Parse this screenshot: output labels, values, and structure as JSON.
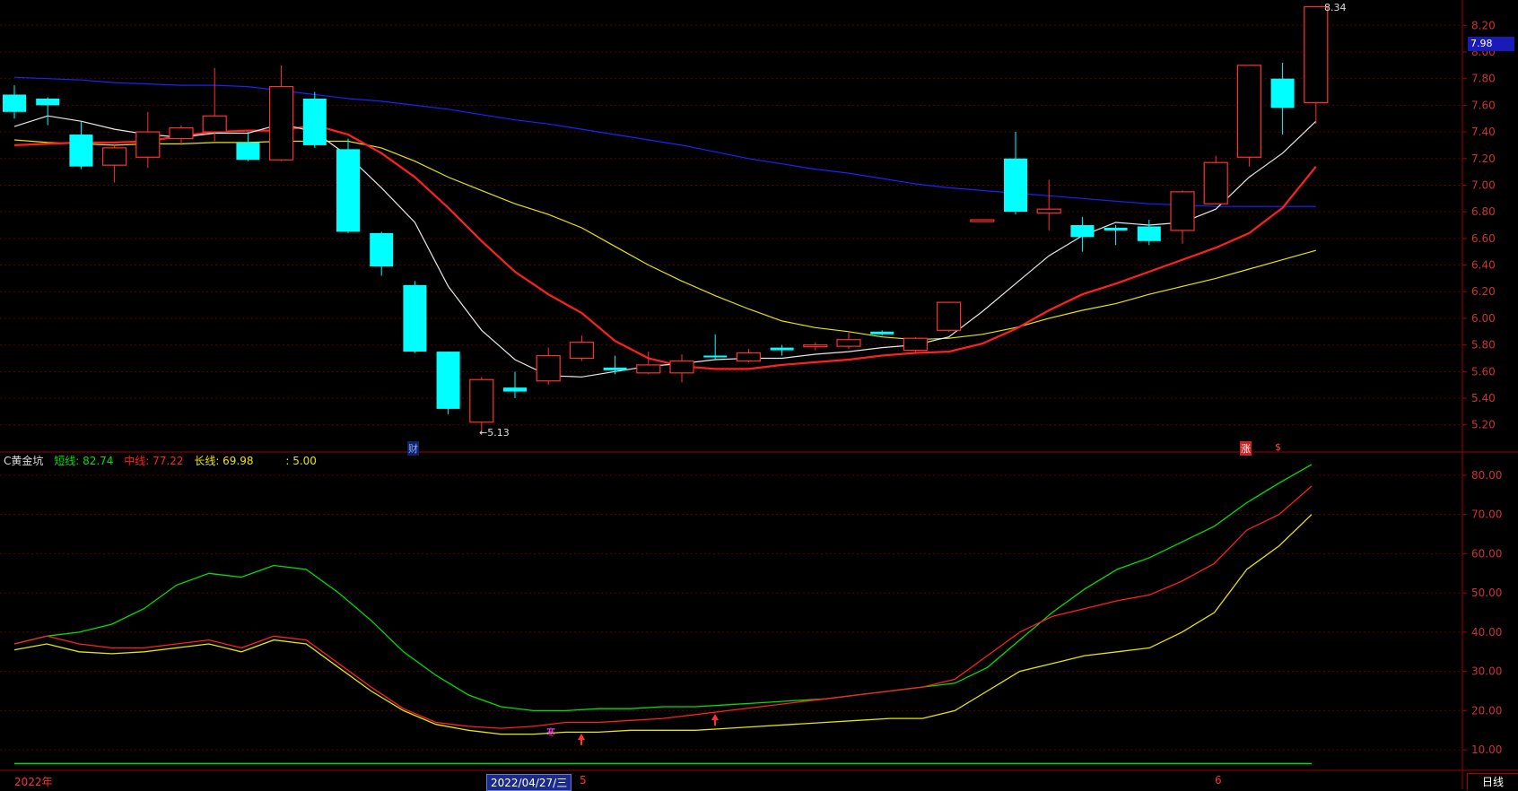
{
  "header": {
    "indicator_name": "C黄金坑",
    "short_label": "短线: 82.74",
    "mid_label": "中线: 77.22",
    "long_label": "长线: 69.98",
    "extra_label": ": 5.00"
  },
  "price_tag": "7.98",
  "x_labels": {
    "year": "2022年",
    "cursor_date": "2022/04/27/三",
    "m5": "5",
    "m6": "6"
  },
  "period": "日线",
  "markers": {
    "cai": "财",
    "zhang": "涨",
    "dollar": "$",
    "hi": "8.34",
    "lo": "←5.13",
    "han": "寒"
  },
  "colors": {
    "up": "#ff3030",
    "down": "#00ffff",
    "ma5": "#e8e8e8",
    "ma10": "#ff2020",
    "ma20": "#e6e600",
    "ma60": "#2020ff",
    "short": "#00e000",
    "mid": "#ff2020",
    "long": "#e6e600",
    "axis": "#a00000"
  },
  "chart_data": [
    {
      "type": "candlestick",
      "ylim": [
        5.05,
        8.35
      ],
      "yticks": [
        "5.20",
        "5.40",
        "5.60",
        "5.80",
        "6.00",
        "6.20",
        "6.40",
        "6.60",
        "6.80",
        "7.00",
        "7.20",
        "7.40",
        "7.60",
        "7.80",
        "8.00",
        "8.20"
      ],
      "candles": [
        {
          "o": 7.68,
          "h": 7.75,
          "l": 7.5,
          "c": 7.55
        },
        {
          "o": 7.65,
          "h": 7.66,
          "l": 7.45,
          "c": 7.6
        },
        {
          "o": 7.38,
          "h": 7.48,
          "l": 7.12,
          "c": 7.14
        },
        {
          "o": 7.15,
          "h": 7.3,
          "l": 7.02,
          "c": 7.28
        },
        {
          "o": 7.21,
          "h": 7.55,
          "l": 7.13,
          "c": 7.4
        },
        {
          "o": 7.35,
          "h": 7.45,
          "l": 7.3,
          "c": 7.43
        },
        {
          "o": 7.4,
          "h": 7.88,
          "l": 7.33,
          "c": 7.52
        },
        {
          "o": 7.32,
          "h": 7.4,
          "l": 7.18,
          "c": 7.19
        },
        {
          "o": 7.19,
          "h": 7.9,
          "l": 7.18,
          "c": 7.74
        },
        {
          "o": 7.65,
          "h": 7.7,
          "l": 7.28,
          "c": 7.3
        },
        {
          "o": 7.27,
          "h": 7.35,
          "l": 6.64,
          "c": 6.65
        },
        {
          "o": 6.64,
          "h": 6.65,
          "l": 6.32,
          "c": 6.39
        },
        {
          "o": 6.25,
          "h": 6.28,
          "l": 5.74,
          "c": 5.75
        },
        {
          "o": 5.75,
          "h": 5.75,
          "l": 5.28,
          "c": 5.32
        },
        {
          "o": 5.22,
          "h": 5.56,
          "l": 5.13,
          "c": 5.54
        },
        {
          "o": 5.48,
          "h": 5.6,
          "l": 5.4,
          "c": 5.45
        },
        {
          "o": 5.53,
          "h": 5.78,
          "l": 5.5,
          "c": 5.72
        },
        {
          "o": 5.7,
          "h": 5.87,
          "l": 5.68,
          "c": 5.82
        },
        {
          "o": 5.63,
          "h": 5.72,
          "l": 5.58,
          "c": 5.61
        },
        {
          "o": 5.59,
          "h": 5.75,
          "l": 5.58,
          "c": 5.65
        },
        {
          "o": 5.59,
          "h": 5.73,
          "l": 5.52,
          "c": 5.68
        },
        {
          "o": 5.72,
          "h": 5.88,
          "l": 5.69,
          "c": 5.71
        },
        {
          "o": 5.68,
          "h": 5.77,
          "l": 5.67,
          "c": 5.74
        },
        {
          "o": 5.78,
          "h": 5.8,
          "l": 5.72,
          "c": 5.76
        },
        {
          "o": 5.79,
          "h": 5.82,
          "l": 5.76,
          "c": 5.8
        },
        {
          "o": 5.79,
          "h": 5.9,
          "l": 5.77,
          "c": 5.84
        },
        {
          "o": 5.9,
          "h": 5.91,
          "l": 5.87,
          "c": 5.88
        },
        {
          "o": 5.76,
          "h": 5.86,
          "l": 5.74,
          "c": 5.85
        },
        {
          "o": 5.91,
          "h": 6.12,
          "l": 5.9,
          "c": 6.12
        },
        {
          "o": 6.74,
          "h": 6.74,
          "l": 6.74,
          "c": 6.74
        },
        {
          "o": 7.2,
          "h": 7.4,
          "l": 6.78,
          "c": 6.8
        },
        {
          "o": 6.79,
          "h": 7.04,
          "l": 6.66,
          "c": 6.82
        },
        {
          "o": 6.7,
          "h": 6.76,
          "l": 6.5,
          "c": 6.61
        },
        {
          "o": 6.68,
          "h": 6.7,
          "l": 6.55,
          "c": 6.66
        },
        {
          "o": 6.69,
          "h": 6.74,
          "l": 6.55,
          "c": 6.58
        },
        {
          "o": 6.66,
          "h": 6.96,
          "l": 6.56,
          "c": 6.95
        },
        {
          "o": 6.86,
          "h": 7.22,
          "l": 6.86,
          "c": 7.17
        },
        {
          "o": 7.21,
          "h": 7.9,
          "l": 7.14,
          "c": 7.9
        },
        {
          "o": 7.8,
          "h": 7.92,
          "l": 7.38,
          "c": 7.58
        },
        {
          "o": 7.62,
          "h": 8.34,
          "l": 7.46,
          "c": 8.34
        }
      ],
      "ma5": [
        7.44,
        7.52,
        7.48,
        7.42,
        7.38,
        7.36,
        7.39,
        7.39,
        7.46,
        7.4,
        7.22,
        6.98,
        6.72,
        6.24,
        5.91,
        5.69,
        5.57,
        5.56,
        5.6,
        5.64,
        5.66,
        5.69,
        5.7,
        5.7,
        5.73,
        5.75,
        5.78,
        5.8,
        5.86,
        6.05,
        6.26,
        6.47,
        6.62,
        6.72,
        6.7,
        6.72,
        6.82,
        7.06,
        7.24,
        7.48
      ],
      "ma10": [
        7.3,
        7.31,
        7.32,
        7.32,
        7.33,
        7.37,
        7.4,
        7.41,
        7.41,
        7.45,
        7.38,
        7.24,
        7.06,
        6.83,
        6.58,
        6.35,
        6.18,
        6.04,
        5.83,
        5.7,
        5.64,
        5.62,
        5.62,
        5.65,
        5.67,
        5.69,
        5.72,
        5.74,
        5.75,
        5.81,
        5.92,
        6.06,
        6.18,
        6.26,
        6.35,
        6.44,
        6.53,
        6.64,
        6.83,
        7.14
      ],
      "ma20": [
        7.34,
        7.32,
        7.31,
        7.3,
        7.31,
        7.31,
        7.32,
        7.32,
        7.33,
        7.33,
        7.33,
        7.28,
        7.18,
        7.06,
        6.96,
        6.86,
        6.78,
        6.68,
        6.54,
        6.4,
        6.28,
        6.17,
        6.07,
        5.98,
        5.93,
        5.9,
        5.86,
        5.84,
        5.85,
        5.88,
        5.93,
        6.0,
        6.06,
        6.11,
        6.18,
        6.24,
        6.3,
        6.37,
        6.44,
        6.51
      ],
      "ma60": [
        7.81,
        7.8,
        7.79,
        7.77,
        7.76,
        7.75,
        7.75,
        7.74,
        7.71,
        7.68,
        7.65,
        7.63,
        7.6,
        7.57,
        7.53,
        7.49,
        7.46,
        7.42,
        7.38,
        7.34,
        7.3,
        7.25,
        7.2,
        7.16,
        7.12,
        7.09,
        7.05,
        7.01,
        6.98,
        6.96,
        6.94,
        6.92,
        6.9,
        6.88,
        6.86,
        6.85,
        6.84,
        6.84,
        6.84,
        6.84
      ]
    },
    {
      "type": "line",
      "title": "C黄金坑",
      "ylim": [
        5,
        85
      ],
      "yticks": [
        "10.00",
        "20.00",
        "30.00",
        "40.00",
        "50.00",
        "60.00",
        "70.00",
        "80.00"
      ],
      "series": [
        {
          "name": "短线",
          "values": [
            37,
            39,
            40,
            42,
            46,
            52,
            55,
            54,
            57,
            56,
            50,
            43,
            35,
            29,
            24,
            21,
            20,
            20,
            20.5,
            20.5,
            21,
            21,
            21.5,
            22,
            22.5,
            23,
            24,
            25,
            26,
            27,
            31,
            38,
            45,
            51,
            56,
            59,
            63,
            67,
            73,
            78,
            82.74
          ]
        },
        {
          "name": "中线",
          "values": [
            37,
            39,
            37,
            36,
            36,
            37,
            38,
            36,
            39,
            38,
            32,
            26,
            20.5,
            17,
            16,
            15.5,
            16,
            17,
            17,
            17.5,
            18,
            19,
            20,
            21,
            22,
            23,
            24,
            25,
            26,
            28,
            34,
            40,
            44,
            46,
            48,
            49.5,
            53,
            57.5,
            66,
            70,
            77.22
          ]
        },
        {
          "name": "长线",
          "values": [
            35.5,
            37,
            35,
            34.5,
            35,
            36,
            37,
            35,
            38,
            37,
            31,
            25,
            20,
            16.5,
            15,
            14,
            14,
            14.5,
            14.5,
            15,
            15,
            15,
            15.5,
            16,
            16.5,
            17,
            17.5,
            18,
            18,
            20,
            25,
            30,
            32,
            34,
            35,
            36,
            40,
            45,
            56,
            62,
            69.98
          ]
        }
      ]
    }
  ]
}
